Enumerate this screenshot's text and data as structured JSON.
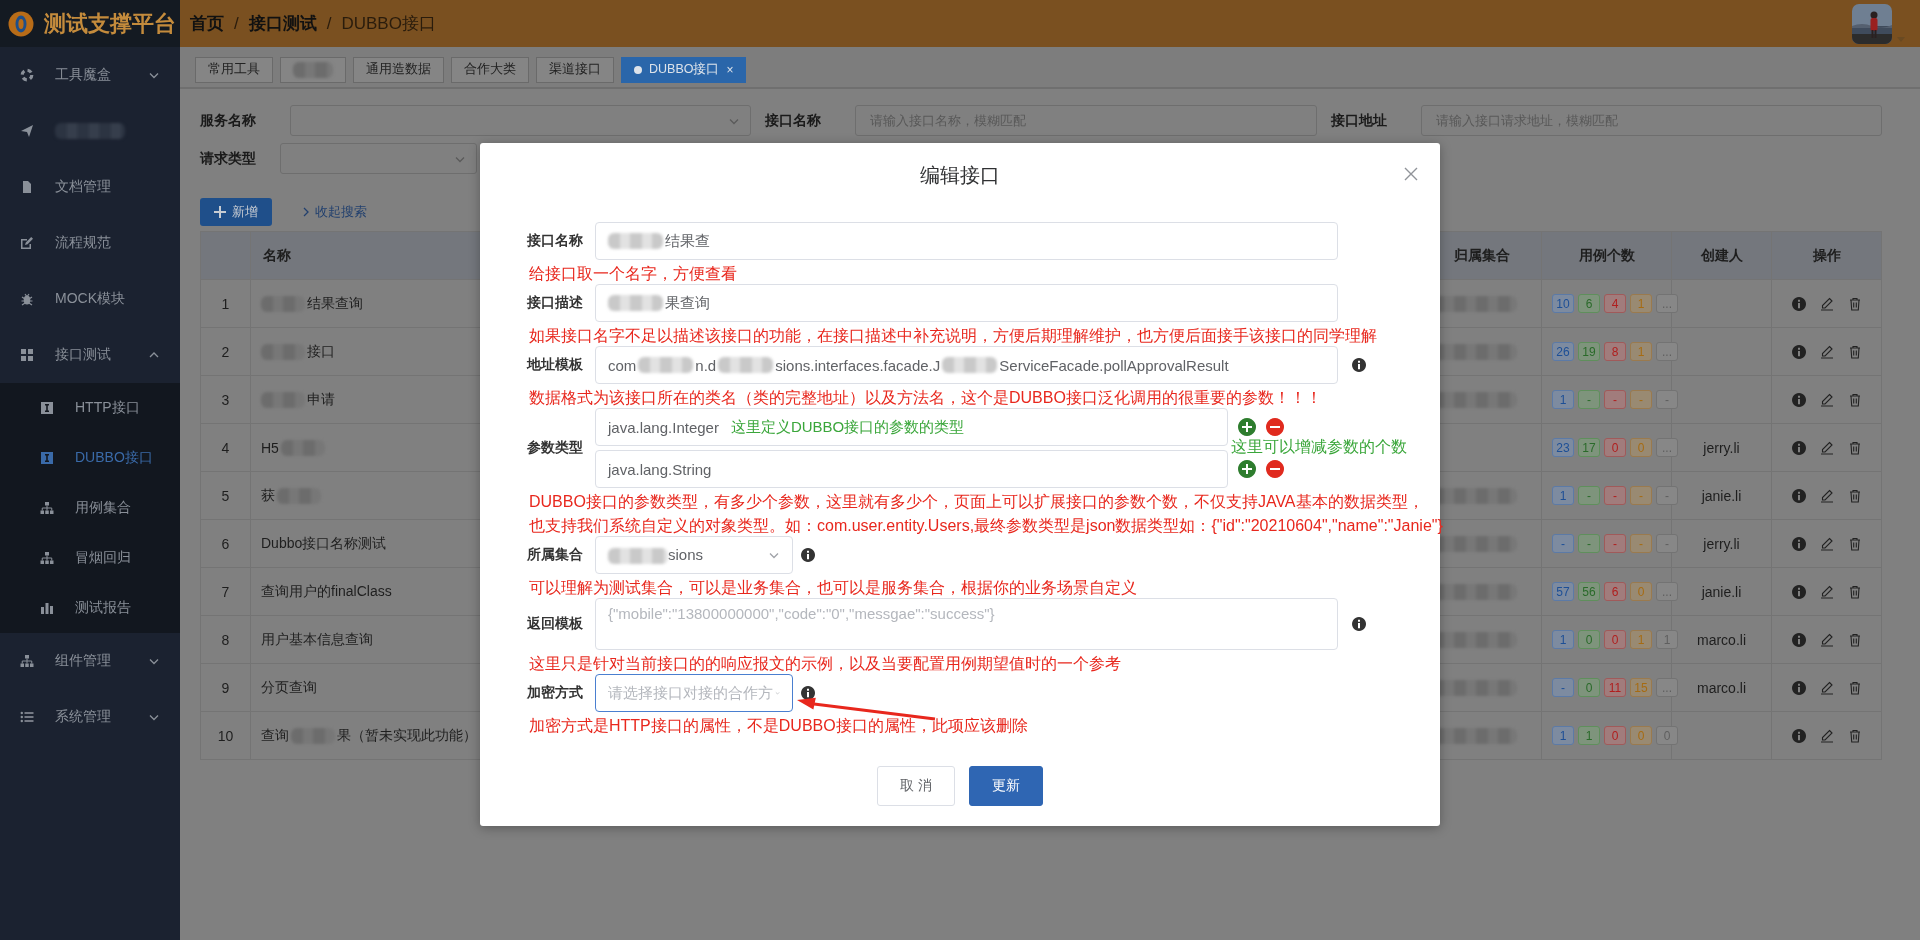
{
  "app": {
    "name": "测试支撑平台"
  },
  "breadcrumb": [
    {
      "label": "首页",
      "current": false
    },
    {
      "separator": "/",
      "label": "接口测试",
      "current": false
    },
    {
      "separator": "/",
      "label": "DUBBO接口",
      "current": true
    }
  ],
  "sidebar": {
    "items": [
      {
        "label": "工具魔盒",
        "kind": "group",
        "expanded": false,
        "selected": false
      },
      {
        "kind": "link",
        "redacted": true,
        "selected": false
      },
      {
        "label": "文档管理",
        "kind": "link",
        "selected": false
      },
      {
        "label": "流程规范",
        "kind": "link",
        "selected": false
      },
      {
        "label": "MOCK模块",
        "kind": "link",
        "selected": false
      },
      {
        "label": "接口测试",
        "kind": "group",
        "expanded": true,
        "selected": false,
        "children": [
          {
            "label": "HTTP接口",
            "selected": false
          },
          {
            "label": "DUBBO接口",
            "selected": true
          },
          {
            "label": "用例集合",
            "selected": false
          },
          {
            "label": "冒烟回归",
            "selected": false
          },
          {
            "label": "测试报告",
            "selected": false
          }
        ]
      },
      {
        "label": "组件管理",
        "kind": "group",
        "expanded": false,
        "selected": false
      },
      {
        "label": "系统管理",
        "kind": "group",
        "expanded": false,
        "selected": false
      }
    ]
  },
  "tabs": [
    {
      "label": "常用工具",
      "selected": false
    },
    {
      "redacted": true,
      "selected": false
    },
    {
      "label": "通用造数据",
      "selected": false
    },
    {
      "label": "合作大类",
      "selected": false
    },
    {
      "label": "渠道接口",
      "selected": false
    },
    {
      "label": "DUBBO接口",
      "selected": true,
      "close": "×"
    }
  ],
  "filters": [
    [
      {
        "label": "服务名称",
        "kind": "select"
      },
      {
        "label": "接口名称",
        "kind": "input",
        "placeholder": "请输入接口名称，模糊匹配"
      },
      {
        "label": "接口地址",
        "kind": "input",
        "placeholder": "请输入接口请求地址，模糊匹配"
      }
    ],
    [
      {
        "label": "请求类型",
        "kind": "select"
      }
    ]
  ],
  "toolbar": {
    "add_button": "新增",
    "collapse_link": "收起搜索"
  },
  "table": {
    "columns": [
      "名称",
      "归属集合",
      "用例个数",
      "创建人",
      "操作"
    ],
    "rows": [
      {
        "index": "1",
        "name": {
          "segments": [
            "结果查询"
          ],
          "redacted_before": true
        },
        "group_redacted": true,
        "cases": [
          "10",
          "6",
          "4",
          "1",
          "..."
        ]
      },
      {
        "index": "2",
        "name": {
          "segments": [
            "接口"
          ],
          "redacted_before": true
        },
        "group_redacted": true,
        "cases": [
          "26",
          "19",
          "8",
          "1",
          "..."
        ]
      },
      {
        "index": "3",
        "name": {
          "segments": [
            "申请"
          ],
          "redacted_before": true
        },
        "group_redacted": true,
        "cases": [
          "1",
          "-",
          "-",
          "-",
          "-"
        ]
      },
      {
        "index": "4",
        "name": {
          "segments": [
            "H5"
          ],
          "redacted_after": true
        },
        "group_redacted": false,
        "cases": [
          "23",
          "17",
          "0",
          "0",
          "..."
        ],
        "creator": "jerry.li"
      },
      {
        "index": "5",
        "name": {
          "segments": [
            "获"
          ],
          "redacted_after": true
        },
        "group_redacted": true,
        "cases": [
          "1",
          "-",
          "-",
          "-",
          "-"
        ],
        "creator": "janie.li"
      },
      {
        "index": "6",
        "name": {
          "segments": [
            "Dubbo接口名称测试"
          ]
        },
        "group_redacted": true,
        "cases": [
          "-",
          "-",
          "-",
          "-",
          "-"
        ],
        "creator": "jerry.li"
      },
      {
        "index": "7",
        "name": {
          "segments": [
            "查询用户的finalClass"
          ]
        },
        "group_redacted": true,
        "cases": [
          "57",
          "56",
          "6",
          "0",
          "..."
        ],
        "creator": "janie.li"
      },
      {
        "index": "8",
        "name": {
          "segments": [
            "用户基本信息查询"
          ]
        },
        "group_redacted": true,
        "cases": [
          "1",
          "0",
          "0",
          "1",
          "1"
        ],
        "creator": "marco.li"
      },
      {
        "index": "9",
        "name": {
          "segments": [
            "分页查询"
          ]
        },
        "group_redacted": true,
        "cases": [
          "-",
          "0",
          "11",
          "15",
          "..."
        ],
        "creator": "marco.li"
      },
      {
        "index": "10",
        "name": {
          "segments": [
            "查询",
            "果（暂未实现此功能）"
          ]
        },
        "group_redacted": true,
        "cases": [
          "1",
          "1",
          "0",
          "0",
          "0"
        ]
      }
    ]
  },
  "dialog": {
    "title": "编辑接口",
    "fields": [
      {
        "label": "接口名称",
        "kind": "text",
        "value": {
          "segments": [
            "结果查"
          ],
          "redacted_before": true
        },
        "info": false,
        "focused": false,
        "arrow": false,
        "notes": [
          {
            "text": "给接口取一个名字，方便查看",
            "color": "#e8271d"
          }
        ]
      },
      {
        "label": "接口描述",
        "kind": "text",
        "value": {
          "segments": [
            "果查询"
          ],
          "redacted_before": true
        },
        "info": false,
        "focused": false,
        "arrow": false,
        "notes": [
          {
            "text": "如果接口名字不足以描述该接口的功能，在接口描述中补充说明，方便后期理解维护，也方便后面接手该接口的同学理解",
            "color": "#e8271d"
          }
        ]
      },
      {
        "label": "地址模板",
        "kind": "text",
        "value": {
          "segments": [
            "com",
            "n.d",
            "sions.interfaces.facade.J",
            "ServiceFacade.pollApprovalResult"
          ]
        },
        "info": true,
        "focused": false,
        "arrow": false,
        "notes": [
          {
            "text": "数据格式为该接口所在的类名（类的完整地址）以及方法名，这个是DUBBO接口泛化调用的很重要的参数！！！",
            "color": "#e8271d"
          }
        ]
      },
      {
        "label": "参数类型",
        "kind": "params",
        "params": [
          {
            "value": "java.lang.Integer",
            "hint": "这里定义DUBBO接口的参数的类型"
          },
          {
            "value": "java.lang.String"
          }
        ],
        "side_note": "这里可以增减参数的个数",
        "info": false,
        "focused": false,
        "arrow": false,
        "notes": [
          {
            "text": "DUBBO接口的参数类型，有多少个参数，这里就有多少个，页面上可以扩展接口的参数个数，不仅支持JAVA基本的数据类型，",
            "color": "#e8271d"
          },
          {
            "text": "也支持我们系统自定义的对象类型。如：com.user.entity.Users,最终参数类型是json数据类型如：{\"id\":\"20210604\",\"name\":\"Janie\"}",
            "color": "#e8271d"
          }
        ]
      },
      {
        "label": "所属集合",
        "kind": "select",
        "value": {
          "segments": [
            "sions"
          ],
          "redacted_before": true
        },
        "info": true,
        "focused": false,
        "arrow": false,
        "notes": [
          {
            "text": "可以理解为测试集合，可以是业务集合，也可以是服务集合，根据你的业务场景自定义",
            "color": "#e8271d"
          }
        ]
      },
      {
        "label": "返回模板",
        "kind": "textarea",
        "placeholder": "{\"mobile\":\"13800000000\",\"code\":\"0\",\"messgae\":\"success\"}",
        "info": true,
        "focused": false,
        "arrow": false,
        "notes": [
          {
            "text": "这里只是针对当前接口的的响应报文的示例，以及当要配置用例期望值时的一个参考",
            "color": "#e8271d"
          }
        ]
      },
      {
        "label": "加密方式",
        "kind": "select",
        "placeholder": "请选择接口对接的合作方",
        "info": true,
        "focused": true,
        "arrow": true,
        "notes": [
          {
            "text": "加密方式是HTTP接口的属性，不是DUBBO接口的属性，此项应该删除",
            "color": "#e8271d"
          }
        ]
      }
    ],
    "buttons": [
      {
        "label": "取 消",
        "kind": "default"
      },
      {
        "label": "更新",
        "kind": "primary"
      }
    ]
  }
}
